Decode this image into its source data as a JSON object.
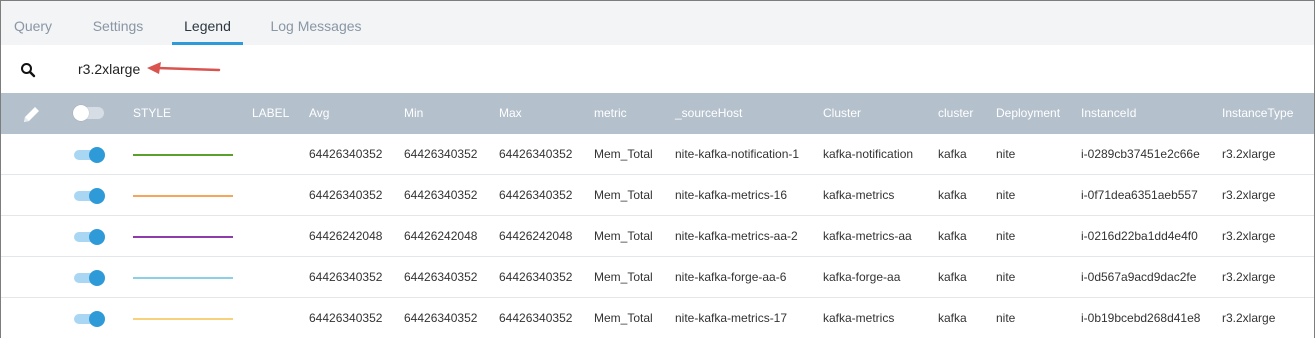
{
  "tabs": [
    {
      "label": "Query",
      "active": false
    },
    {
      "label": "Settings",
      "active": false
    },
    {
      "label": "Legend",
      "active": true
    },
    {
      "label": "Log Messages",
      "active": false
    }
  ],
  "search": {
    "value": "r3.2xlarge",
    "icon": "search-icon"
  },
  "colors": {
    "accent": "#2f9ad8",
    "header_bg": "#b4c0cc",
    "annotation_arrow": "#d9534f"
  },
  "table": {
    "header_icon": "pencil-icon",
    "columns": [
      "STYLE",
      "LABEL",
      "Avg",
      "Min",
      "Max",
      "metric",
      "_sourceHost",
      "Cluster",
      "cluster",
      "Deployment",
      "InstanceId",
      "InstanceType"
    ],
    "rows": [
      {
        "enabled": true,
        "color": "#5aa02c",
        "label": "",
        "avg": "64426340352",
        "min": "64426340352",
        "max": "64426340352",
        "metric": "Mem_Total",
        "sourceHost": "nite-kafka-notification-1",
        "Cluster": "kafka-notification",
        "cluster": "kafka",
        "deployment": "nite",
        "instanceId": "i-0289cb37451e2c66e",
        "instanceType": "r3.2xlarge"
      },
      {
        "enabled": true,
        "color": "#f5a65b",
        "label": "",
        "avg": "64426340352",
        "min": "64426340352",
        "max": "64426340352",
        "metric": "Mem_Total",
        "sourceHost": "nite-kafka-metrics-16",
        "Cluster": "kafka-metrics",
        "cluster": "kafka",
        "deployment": "nite",
        "instanceId": "i-0f71dea6351aeb557",
        "instanceType": "r3.2xlarge"
      },
      {
        "enabled": true,
        "color": "#8e3bab",
        "label": "",
        "avg": "64426242048",
        "min": "64426242048",
        "max": "64426242048",
        "metric": "Mem_Total",
        "sourceHost": "nite-kafka-metrics-aa-2",
        "Cluster": "kafka-metrics-aa",
        "cluster": "kafka",
        "deployment": "nite",
        "instanceId": "i-0216d22ba1dd4e4f0",
        "instanceType": "r3.2xlarge"
      },
      {
        "enabled": true,
        "color": "#8cd0e8",
        "label": "",
        "avg": "64426340352",
        "min": "64426340352",
        "max": "64426340352",
        "metric": "Mem_Total",
        "sourceHost": "nite-kafka-forge-aa-6",
        "Cluster": "kafka-forge-aa",
        "cluster": "kafka",
        "deployment": "nite",
        "instanceId": "i-0d567a9acd9dac2fe",
        "instanceType": "r3.2xlarge"
      },
      {
        "enabled": true,
        "color": "#f7d27a",
        "label": "",
        "avg": "64426340352",
        "min": "64426340352",
        "max": "64426340352",
        "metric": "Mem_Total",
        "sourceHost": "nite-kafka-metrics-17",
        "Cluster": "kafka-metrics",
        "cluster": "kafka",
        "deployment": "nite",
        "instanceId": "i-0b19bcebd268d41e8",
        "instanceType": "r3.2xlarge"
      }
    ]
  }
}
